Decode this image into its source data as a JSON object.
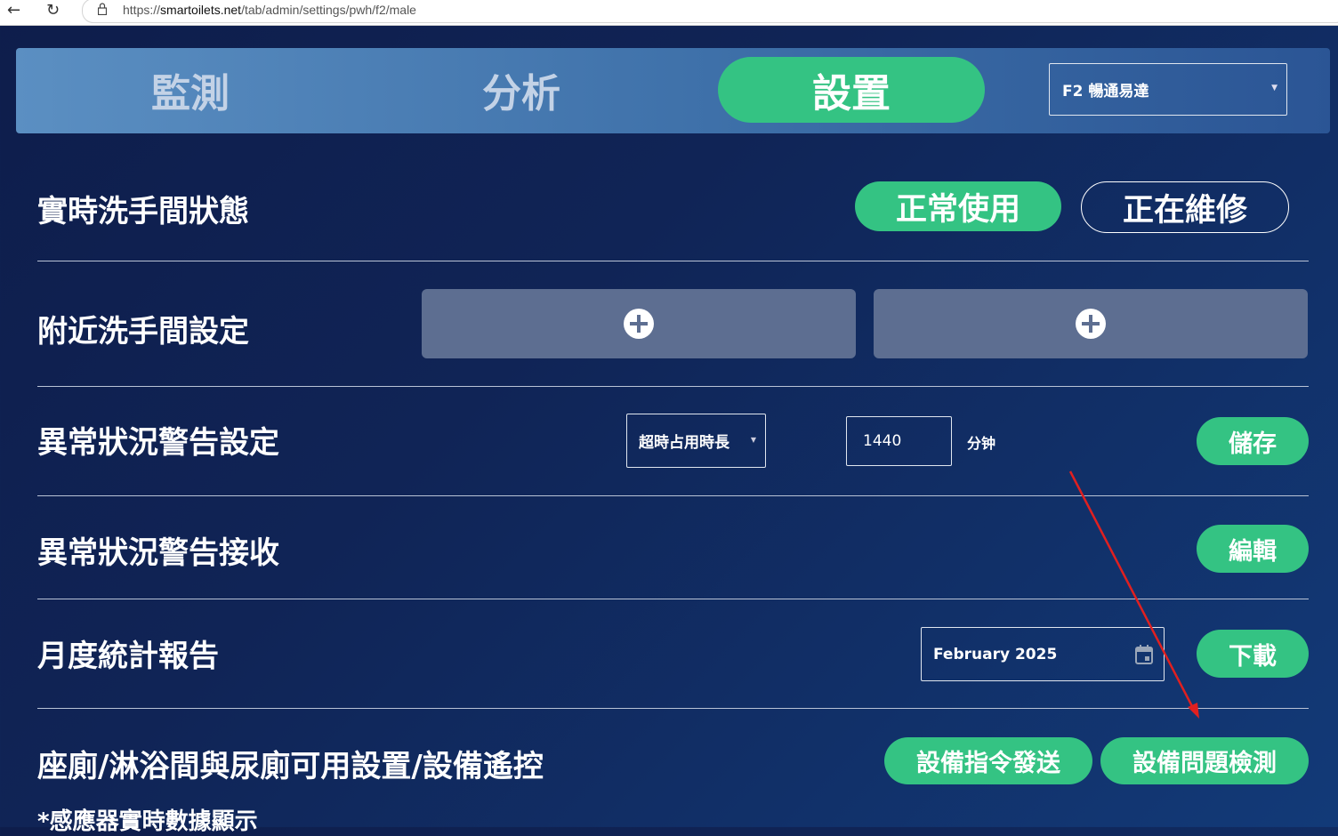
{
  "browser": {
    "url_prefix": "https://",
    "url_host": "smartoilets.net",
    "url_path": "/tab/admin/settings/pwh/f2/male"
  },
  "tabs": [
    {
      "label": "監測"
    },
    {
      "label": "分析"
    },
    {
      "label": "設置"
    }
  ],
  "location_select": {
    "value": "F2 暢通易達"
  },
  "status_row": {
    "title": "實時洗手間狀態",
    "normal_button": "正常使用",
    "maintenance_button": "正在維修"
  },
  "nearby_row": {
    "title": "附近洗手間設定"
  },
  "alert_setting_row": {
    "title": "異常狀況警告設定",
    "type_select": "超時占用時長",
    "minutes_value": "1440",
    "unit": "分钟",
    "save_button": "儲存"
  },
  "alert_receive_row": {
    "title": "異常狀況警告接收",
    "edit_button": "編輯"
  },
  "monthly_row": {
    "title": "月度統計報告",
    "month_value": "February 2025",
    "download_button": "下載"
  },
  "device_row": {
    "title": "座廁/淋浴間與尿廁可用設置/設備遙控",
    "send_command_button": "設備指令發送",
    "detect_button": "設備問題檢測",
    "footnote": "*感應器實時數據顯示"
  },
  "colors": {
    "accent_green": "#34c383",
    "annotation_arrow": "#e02020"
  }
}
